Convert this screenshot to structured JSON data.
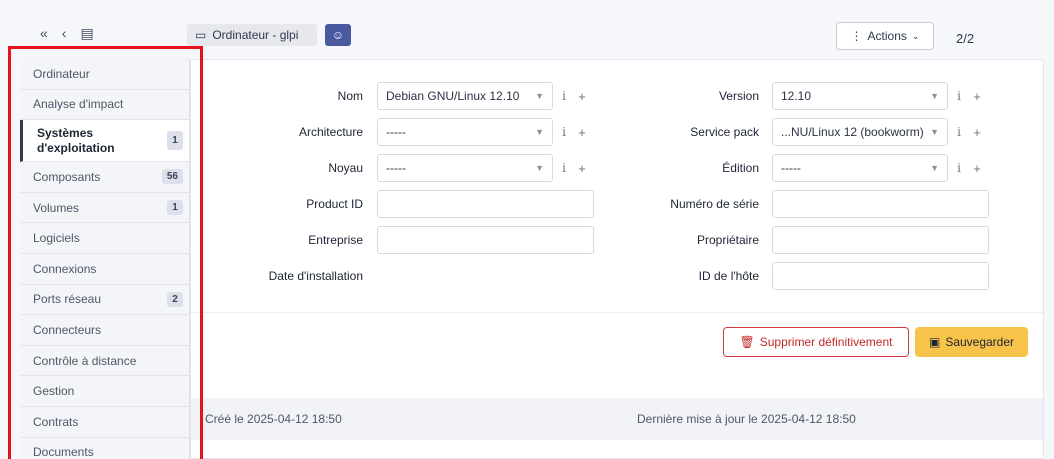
{
  "header": {
    "breadcrumb": "Ordinateur - glpi",
    "actions_label": "Actions",
    "pager": "2/2"
  },
  "sidebar": {
    "items": [
      {
        "label": "Ordinateur",
        "badge": ""
      },
      {
        "label": "Analyse d'impact",
        "badge": ""
      },
      {
        "label": "Systèmes d'exploitation",
        "badge": "1",
        "active": true
      },
      {
        "label": "Composants",
        "badge": "56"
      },
      {
        "label": "Volumes",
        "badge": "1"
      },
      {
        "label": "Logiciels",
        "badge": ""
      },
      {
        "label": "Connexions",
        "badge": ""
      },
      {
        "label": "Ports réseau",
        "badge": "2"
      },
      {
        "label": "Connecteurs",
        "badge": ""
      },
      {
        "label": "Contrôle à distance",
        "badge": ""
      },
      {
        "label": "Gestion",
        "badge": ""
      },
      {
        "label": "Contrats",
        "badge": ""
      },
      {
        "label": "Documents",
        "badge": ""
      }
    ]
  },
  "form": {
    "nom_label": "Nom",
    "nom_value": "Debian GNU/Linux 12.10",
    "architecture_label": "Architecture",
    "architecture_value": "-----",
    "noyau_label": "Noyau",
    "noyau_value": "-----",
    "product_id_label": "Product ID",
    "entreprise_label": "Entreprise",
    "date_install_label": "Date d'installation",
    "version_label": "Version",
    "version_value": "12.10",
    "service_pack_label": "Service pack",
    "service_pack_value": "...NU/Linux 12 (bookworm)",
    "edition_label": "Édition",
    "edition_value": "-----",
    "serial_label": "Numéro de série",
    "owner_label": "Propriétaire",
    "host_id_label": "ID de l'hôte"
  },
  "buttons": {
    "delete_label": "Supprimer définitivement",
    "save_label": "Sauvegarder"
  },
  "footer": {
    "created": "Créé le 2025-04-12 18:50",
    "updated": "Dernière mise à jour le 2025-04-12 18:50"
  },
  "colors": {
    "highlight": "#e8101a",
    "save": "#f7c34a",
    "delete": "#d63939"
  }
}
